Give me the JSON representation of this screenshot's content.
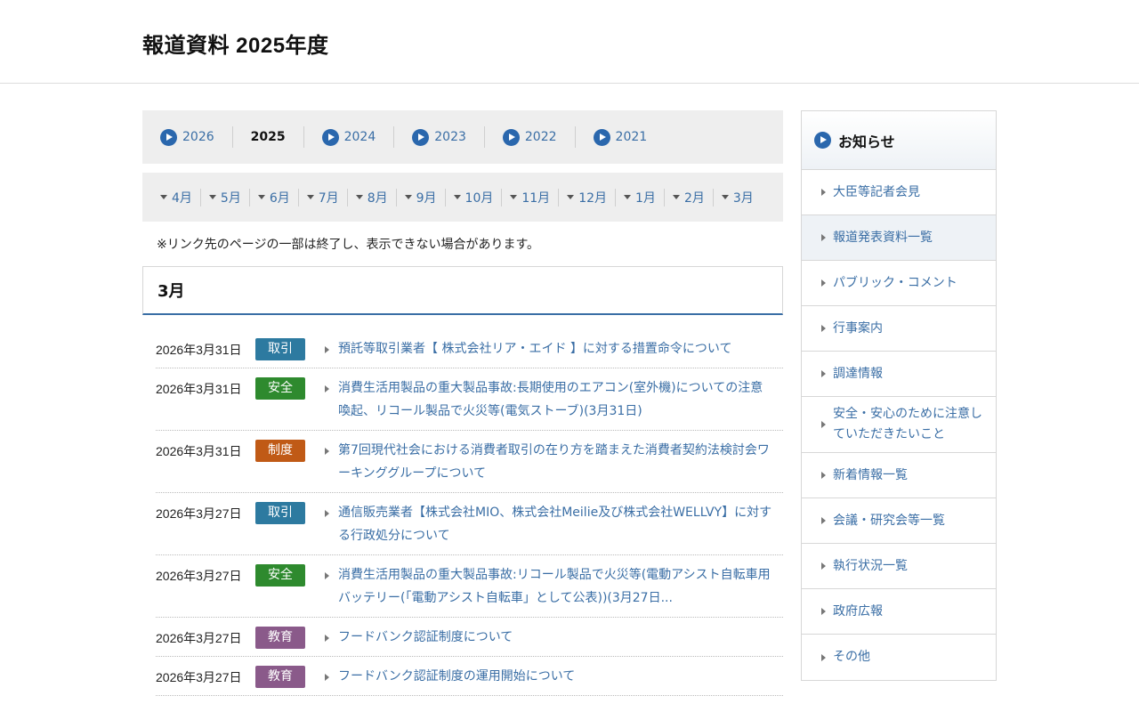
{
  "page": {
    "title": "報道資料 2025年度"
  },
  "colors": {
    "link": "#3a6ea5",
    "accent": "#2a67ad",
    "tag_trade": "#2d7aa0",
    "tag_safety": "#2e8a2e",
    "tag_system": "#c05a16",
    "tag_education": "#8a5a8a"
  },
  "year_tabs": [
    {
      "label": "2026",
      "current": false,
      "icon": "play-circle-icon"
    },
    {
      "label": "2025",
      "current": true
    },
    {
      "label": "2024",
      "current": false,
      "icon": "play-circle-icon"
    },
    {
      "label": "2023",
      "current": false,
      "icon": "play-circle-icon"
    },
    {
      "label": "2022",
      "current": false,
      "icon": "play-circle-icon"
    },
    {
      "label": "2021",
      "current": false,
      "icon": "play-circle-icon"
    }
  ],
  "month_tabs": [
    "4月",
    "5月",
    "6月",
    "7月",
    "8月",
    "9月",
    "10月",
    "11月",
    "12月",
    "1月",
    "2月",
    "3月"
  ],
  "notice": "※リンク先のページの一部は終了し、表示できない場合があります。",
  "section": {
    "title": "3月"
  },
  "news": [
    {
      "date": "2026年3月31日",
      "tag": "取引",
      "tag_color": "#2d7aa0",
      "title": "預託等取引業者【 株式会社リア・エイド 】に対する措置命令について"
    },
    {
      "date": "2026年3月31日",
      "tag": "安全",
      "tag_color": "#2e8a2e",
      "title": "消費生活用製品の重大製品事故:長期使用のエアコン(室外機)についての注意喚起、リコール製品で火災等(電気ストーブ)(3月31日)"
    },
    {
      "date": "2026年3月31日",
      "tag": "制度",
      "tag_color": "#c05a16",
      "title": "第7回現代社会における消費者取引の在り方を踏まえた消費者契約法検討会ワーキンググループについて"
    },
    {
      "date": "2026年3月27日",
      "tag": "取引",
      "tag_color": "#2d7aa0",
      "title": "通信販売業者【株式会社MIO、株式会社Meilie及び株式会社WELLVY】に対する行政処分について"
    },
    {
      "date": "2026年3月27日",
      "tag": "安全",
      "tag_color": "#2e8a2e",
      "title": "消費生活用製品の重大製品事故:リコール製品で火災等(電動アシスト自転車用バッテリー(「電動アシスト自転車」として公表))(3月27日..."
    },
    {
      "date": "2026年3月27日",
      "tag": "教育",
      "tag_color": "#8a5a8a",
      "title": "フードバンク認証制度について"
    },
    {
      "date": "2026年3月27日",
      "tag": "教育",
      "tag_color": "#8a5a8a",
      "title": "フードバンク認証制度の運用開始について"
    }
  ],
  "sidebar": {
    "title": "お知らせ",
    "items": [
      {
        "label": "大臣等記者会見",
        "active": false
      },
      {
        "label": "報道発表資料一覧",
        "active": true
      },
      {
        "label": "パブリック・コメント",
        "active": false
      },
      {
        "label": "行事案内",
        "active": false
      },
      {
        "label": "調達情報",
        "active": false
      },
      {
        "label": "安全・安心のために注意していただきたいこと",
        "active": false
      },
      {
        "label": "新着情報一覧",
        "active": false
      },
      {
        "label": "会議・研究会等一覧",
        "active": false
      },
      {
        "label": "執行状況一覧",
        "active": false
      },
      {
        "label": "政府広報",
        "active": false
      },
      {
        "label": "その他",
        "active": false
      }
    ]
  }
}
